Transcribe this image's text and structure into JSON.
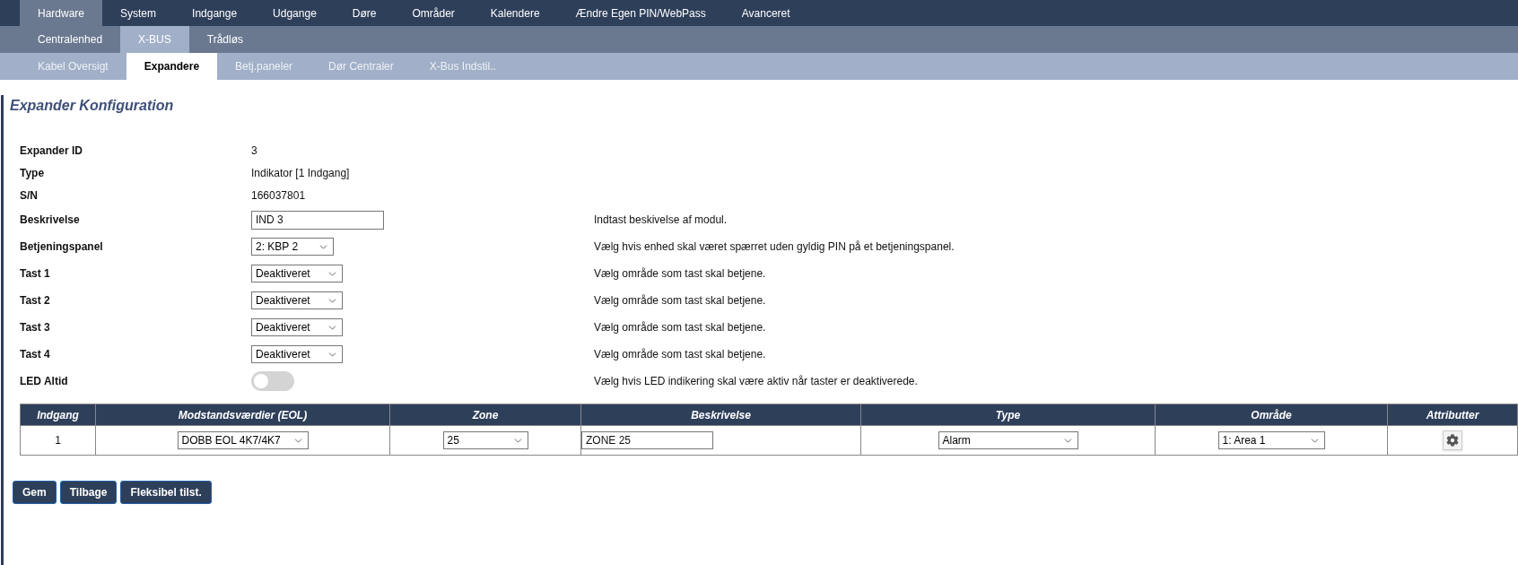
{
  "nav_primary": [
    {
      "label": "Hardware",
      "selected": true
    },
    {
      "label": "System",
      "selected": false
    },
    {
      "label": "Indgange",
      "selected": false
    },
    {
      "label": "Udgange",
      "selected": false
    },
    {
      "label": "Døre",
      "selected": false
    },
    {
      "label": "Områder",
      "selected": false
    },
    {
      "label": "Kalendere",
      "selected": false
    },
    {
      "label": "Ændre Egen PIN/WebPass",
      "selected": false
    },
    {
      "label": "Avanceret",
      "selected": false
    }
  ],
  "nav_secondary": [
    {
      "label": "Centralenhed",
      "selected": false
    },
    {
      "label": "X-BUS",
      "selected": true
    },
    {
      "label": "Trådløs",
      "selected": false
    }
  ],
  "nav_tertiary": [
    {
      "label": "Kabel Oversigt",
      "selected": false
    },
    {
      "label": "Expandere",
      "selected": true
    },
    {
      "label": "Betj.paneler",
      "selected": false
    },
    {
      "label": "Dør Centraler",
      "selected": false
    },
    {
      "label": "X-Bus Indstil..",
      "selected": false
    }
  ],
  "title": "Expander Konfiguration",
  "fields": [
    {
      "kind": "text",
      "label": "Expander ID",
      "value": "3"
    },
    {
      "kind": "text",
      "label": "Type",
      "value": "Indikator [1 Indgang]"
    },
    {
      "kind": "text",
      "label": "S/N",
      "value": "166037801"
    },
    {
      "kind": "input",
      "label": "Beskrivelse",
      "value": "IND 3",
      "help": "Indtast beskivelse af modul."
    },
    {
      "kind": "select",
      "label": "Betjeningspanel",
      "value": "2: KBP 2",
      "help": "Vælg hvis enhed skal været spærret uden gyldig PIN på et betjeningspanel."
    },
    {
      "kind": "select",
      "label": "Tast 1",
      "value": "Deaktiveret",
      "help": "Vælg område som tast skal betjene."
    },
    {
      "kind": "select",
      "label": "Tast 2",
      "value": "Deaktiveret",
      "help": "Vælg område som tast skal betjene."
    },
    {
      "kind": "select",
      "label": "Tast 3",
      "value": "Deaktiveret",
      "help": "Vælg område som tast skal betjene."
    },
    {
      "kind": "select",
      "label": "Tast 4",
      "value": "Deaktiveret",
      "help": "Vælg område som tast skal betjene."
    },
    {
      "kind": "toggle",
      "label": "LED Altid",
      "on": false,
      "help": "Vælg hvis LED indikering skal være aktiv når taster er deaktiverede."
    }
  ],
  "table": {
    "columns": [
      "Indgang",
      "Modstandsværdier (EOL)",
      "Zone",
      "Beskrivelse",
      "Type",
      "Område",
      "Attributter"
    ],
    "rows": [
      {
        "cells": [
          {
            "kind": "text",
            "value": "1"
          },
          {
            "kind": "select",
            "value": "DOBB EOL 4K7/4K7"
          },
          {
            "kind": "select",
            "value": "25"
          },
          {
            "kind": "input",
            "value": "ZONE 25"
          },
          {
            "kind": "select",
            "value": "Alarm"
          },
          {
            "kind": "select",
            "value": "1: Area 1"
          },
          {
            "kind": "gear"
          }
        ]
      }
    ]
  },
  "buttons": [
    "Gem",
    "Tilbage",
    "Fleksibel tilst."
  ]
}
